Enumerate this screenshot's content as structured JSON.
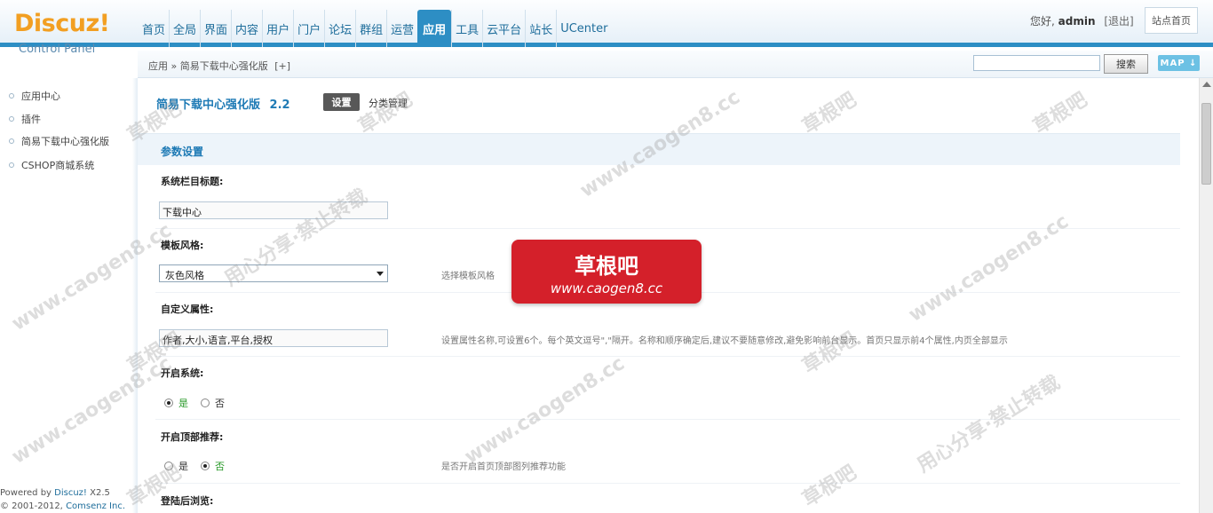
{
  "logo": {
    "brand": "Discuz!",
    "subtitle": "Control Panel"
  },
  "nav": {
    "items": [
      {
        "label": "首页"
      },
      {
        "label": "全局"
      },
      {
        "label": "界面"
      },
      {
        "label": "内容"
      },
      {
        "label": "用户"
      },
      {
        "label": "门户"
      },
      {
        "label": "论坛"
      },
      {
        "label": "群组"
      },
      {
        "label": "运营"
      },
      {
        "label": "应用",
        "active": true
      },
      {
        "label": "工具"
      },
      {
        "label": "云平台"
      },
      {
        "label": "站长"
      },
      {
        "label": "UCenter"
      }
    ]
  },
  "user": {
    "greeting": "您好,",
    "name": "admin",
    "logout": "[退出]",
    "site_home": "站点首页"
  },
  "breadcrumb": {
    "root": "应用",
    "sep": "»",
    "current": "简易下载中心强化版",
    "add": "[+]"
  },
  "search": {
    "value": "",
    "button": "搜索",
    "map": "MAP ↓"
  },
  "sidebar": {
    "items": [
      {
        "label": "应用中心"
      },
      {
        "label": "插件"
      },
      {
        "label": "简易下载中心强化版"
      },
      {
        "label": "CSHOP商城系统"
      }
    ],
    "powered": "Powered by",
    "powered_link": "Discuz!",
    "version": "X2.5",
    "copyright": "© 2001-2012,",
    "company": "Comsenz Inc."
  },
  "main": {
    "plugin_title": "简易下载中心强化版",
    "plugin_version": "2.2",
    "tab_settings": "设置",
    "tab_category": "分类管理",
    "section": "参数设置",
    "fields": {
      "title_label": "系统栏目标题:",
      "title_value": "下载中心",
      "style_label": "模板风格:",
      "style_value": "灰色风格",
      "style_hint": "选择模板风格",
      "attr_label": "自定义属性:",
      "attr_value": "作者,大小,语言,平台,授权",
      "attr_hint": "设置属性名称,可设置6个。每个英文逗号\",\"隔开。名称和顺序确定后,建议不要随意修改,避免影响前台显示。首页只显示前4个属性,内页全部显示",
      "enable_label": "开启系统:",
      "enable_yes": "是",
      "enable_no": "否",
      "top_label": "开启顶部推荐:",
      "top_yes": "是",
      "top_no": "否",
      "top_hint": "是否开启首页顶部图列推荐功能",
      "login_label": "登陆后浏览:"
    }
  },
  "watermark": {
    "badge_title": "草根吧",
    "badge_url": "www.caogen8.cc",
    "mark1": "草根吧",
    "mark2": "www.caogen8.cc",
    "mark3": "用心分享·禁止转载"
  }
}
